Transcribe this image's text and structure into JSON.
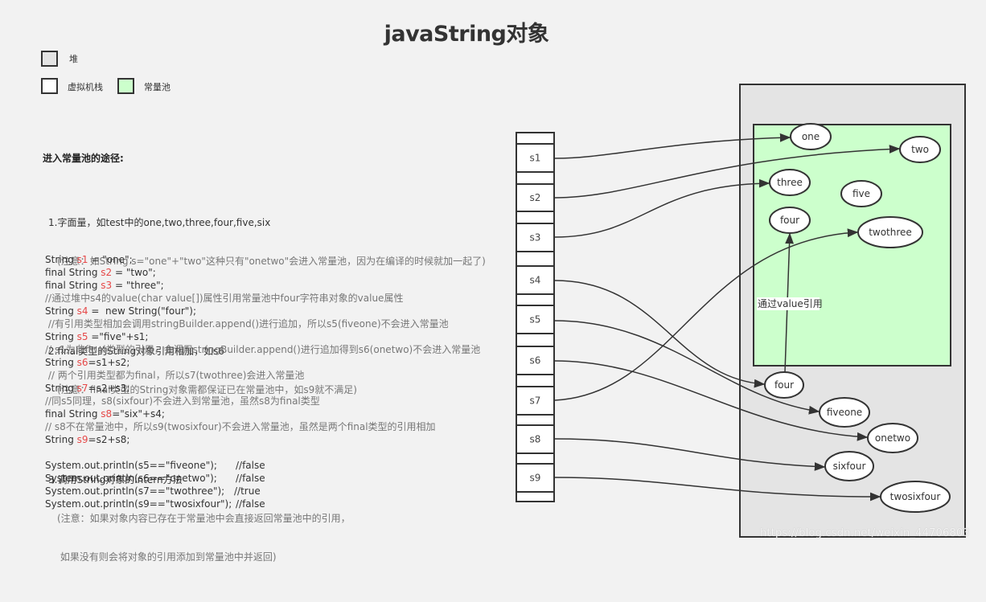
{
  "title": "javaString对象",
  "legend": [
    {
      "label": "堆",
      "color": "#e4e4e4"
    },
    {
      "label": "虚拟机栈",
      "color": "#ffffff"
    },
    {
      "label": "常量池",
      "color": "#ccffcc"
    }
  ],
  "notes": {
    "heading": "进入常量池的途径:",
    "items": [
      {
        "main": "1.字面量，如test中的one,two,three,four,five,six",
        "note": [
          "(注意：如String s=\"one\"+\"two\"这种只有\"onetwo\"会进入常量池，因为在编译的时候就加一起了)"
        ]
      },
      {
        "main": "2.final类型的String对象引用相加，如s6",
        "note": [
          "(注意：final类型的String对象需都保证已在常量池中，如s9就不满足)"
        ]
      },
      {
        "main": "3.调用String对象的intern方法",
        "note": [
          "(注意：如果对象内容已存在于常量池中会直接返回常量池中的引用，",
          " 如果没有则会将对象的引用添加到常量池中并返回)"
        ]
      }
    ]
  },
  "code": [
    {
      "type": "stmt",
      "pre": "String ",
      "var": "s1",
      "post": " = \"one\";"
    },
    {
      "type": "stmt",
      "pre": "final String ",
      "var": "s2",
      "post": " = \"two\";"
    },
    {
      "type": "stmt",
      "pre": "final String ",
      "var": "s3",
      "post": " = \"three\";"
    },
    {
      "type": "comment",
      "text": "//通过堆中s4的value(char value[])属性引用常量池中four字符串对象的value属性"
    },
    {
      "type": "stmt",
      "pre": "String ",
      "var": "s4",
      "post": " =  new String(\"four\");"
    },
    {
      "type": "comment",
      "text": " //有引用类型相加会调用stringBuilder.append()进行追加，所以s5(fiveone)不会进入常量池"
    },
    {
      "type": "stmt",
      "pre": "String ",
      "var": "s5",
      "post": " =\"five\"+s1;"
    },
    {
      "type": "comment",
      "text": "// s1为非final类型的引用，会调用stringBuilder.append()进行追加得到s6(onetwo)不会进入常量池"
    },
    {
      "type": "stmt",
      "pre": "String ",
      "var": "s6",
      "post": "=s1+s2;"
    },
    {
      "type": "comment",
      "text": " // 两个引用类型都为final，所以s7(twothree)会进入常量池"
    },
    {
      "type": "stmt",
      "pre": "String ",
      "var": "s7",
      "post": "=s2+s3;"
    },
    {
      "type": "comment",
      "text": "//同s5同理，s8(sixfour)不会进入到常量池，虽然s8为final类型"
    },
    {
      "type": "stmt",
      "pre": "final String ",
      "var": "s8",
      "post": "=\"six\"+s4;"
    },
    {
      "type": "comment",
      "text": "// s8不在常量池中，所以s9(twosixfour)不会进入常量池，虽然是两个final类型的引用相加"
    },
    {
      "type": "stmt",
      "pre": "String ",
      "var": "s9",
      "post": "=s2+s8;"
    },
    {
      "type": "blank"
    },
    {
      "type": "print",
      "text": "System.out.println(s5==\"fiveone\");",
      "result": "//false"
    },
    {
      "type": "print",
      "text": "System.out.println(s6==\"onetwo\");",
      "result": "//false"
    },
    {
      "type": "print",
      "text": "System.out.println(s7==\"twothree\");",
      "result": "//true"
    },
    {
      "type": "print",
      "text": "System.out.println(s9==\"twosixfour\");",
      "result": "//false"
    }
  ],
  "stack": {
    "label": "虚拟机栈",
    "slots": [
      "s1",
      "s2",
      "s3",
      "s4",
      "s5",
      "s6",
      "s7",
      "s8",
      "s9"
    ]
  },
  "heap": {
    "label": "堆",
    "pool_label": "常量池",
    "pool_nodes": [
      "one",
      "two",
      "three",
      "five",
      "four",
      "twothree"
    ],
    "heap_nodes": [
      "four",
      "fiveone",
      "onetwo",
      "sixfour",
      "twosixfour"
    ],
    "value_ref_label": "通过value引用"
  },
  "references": [
    {
      "from": "s1",
      "to": "one"
    },
    {
      "from": "s2",
      "to": "two"
    },
    {
      "from": "s3",
      "to": "three"
    },
    {
      "from": "s4",
      "to": "four (heap)"
    },
    {
      "from": "s5",
      "to": "fiveone"
    },
    {
      "from": "s6",
      "to": "onetwo"
    },
    {
      "from": "s7",
      "to": "twothree"
    },
    {
      "from": "s8",
      "to": "sixfour"
    },
    {
      "from": "s9",
      "to": "twosixfour"
    },
    {
      "from": "four (heap)",
      "to": "four (pool)",
      "label": "通过value引用"
    }
  ],
  "watermark": "https://blog.csdn.net/weixin_44706803"
}
